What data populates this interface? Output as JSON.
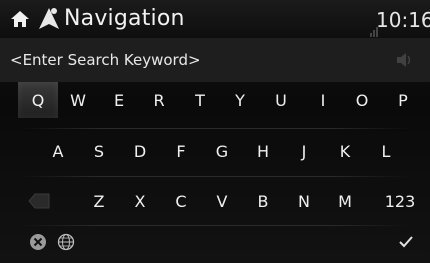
{
  "header": {
    "home_icon": "home-icon",
    "nav_icon": "navigation-icon",
    "title": "Navigation",
    "clock": "10:16"
  },
  "search": {
    "placeholder": "<Enter Search Keyword>",
    "value": "",
    "voice_icon": "speaker-icon"
  },
  "keyboard": {
    "row1": [
      "Q",
      "W",
      "E",
      "R",
      "T",
      "Y",
      "U",
      "I",
      "O",
      "P"
    ],
    "row2": [
      "A",
      "S",
      "D",
      "F",
      "G",
      "H",
      "J",
      "K",
      "L"
    ],
    "row3": [
      "Z",
      "X",
      "C",
      "V",
      "B",
      "N",
      "M",
      "123"
    ],
    "backspace_icon": "backspace-icon",
    "delete_icon": "clear-icon",
    "language_icon": "globe-icon",
    "confirm_icon": "check-icon",
    "highlighted_key": "Q"
  },
  "colors": {
    "background": "#0b0b0b",
    "text": "#e6e6e6",
    "search_bar": "#1e1e1e"
  }
}
